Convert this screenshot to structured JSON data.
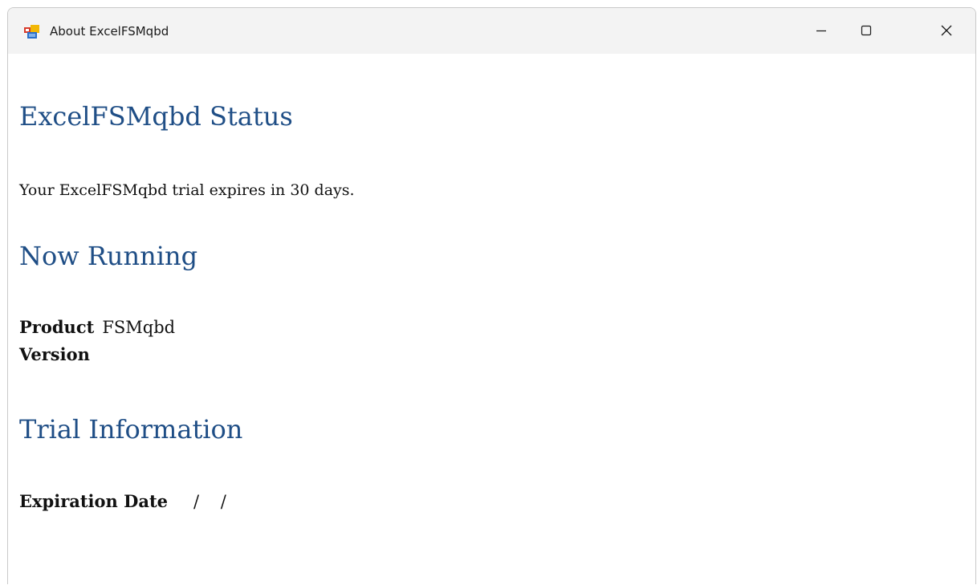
{
  "window": {
    "title": "About ExcelFSMqbd",
    "icon": "application-icon",
    "controls": {
      "minimize": "minimize-icon",
      "maximize": "maximize-icon",
      "close": "close-icon"
    }
  },
  "status": {
    "heading": "ExcelFSMqbd Status",
    "message": "Your ExcelFSMqbd trial expires in 30 days."
  },
  "running": {
    "heading": "Now Running",
    "product_label": "Product",
    "product_value": "FSMqbd",
    "version_label": "Version",
    "version_value": ""
  },
  "trial": {
    "heading": "Trial Information",
    "expiration_label": "Expiration Date",
    "expiration_value": "/    /"
  },
  "colors": {
    "heading": "#1f4e86",
    "titlebar": "#f3f3f3",
    "text": "#111111"
  }
}
